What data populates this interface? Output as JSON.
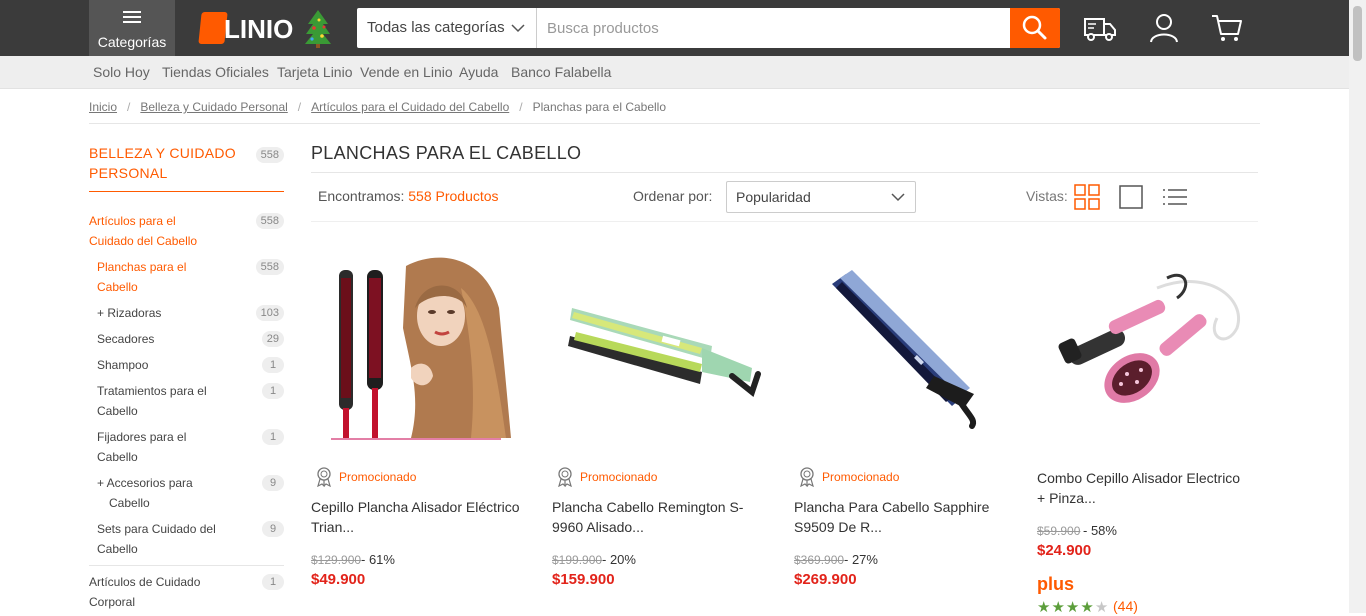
{
  "header": {
    "categories_label": "Categorías",
    "logo_text": "LINIO",
    "search": {
      "category_value": "Todas las categorías",
      "placeholder": "Busca productos"
    },
    "icons": [
      "shipping-truck-icon",
      "user-icon",
      "cart-icon"
    ]
  },
  "nav": {
    "links": [
      "Solo Hoy",
      "Tiendas Oficiales",
      "Tarjeta Linio",
      "Vende en Linio",
      "Ayuda",
      "Banco Falabella"
    ]
  },
  "breadcrumb": [
    "Inicio",
    "Belleza y Cuidado Personal",
    "Artículos para el Cuidado del Cabello",
    "Planchas para el Cabello"
  ],
  "sidebar": {
    "heading_line1": "BELLEZA Y CUIDADO",
    "heading_line2": "PERSONAL",
    "heading_count": "558",
    "items": [
      {
        "l1": "Artículos para el",
        "l2": "Cuidado del Cabello",
        "count": "558"
      },
      {
        "l1": "Planchas para el",
        "l2": "Cabello",
        "count": "558"
      },
      {
        "l1": "+ Rizadoras",
        "l2": "",
        "count": "103"
      },
      {
        "l1": "Secadores",
        "l2": "",
        "count": "29"
      },
      {
        "l1": "Shampoo",
        "l2": "",
        "count": "1"
      },
      {
        "l1": "Tratamientos para el",
        "l2": "Cabello",
        "count": "1"
      },
      {
        "l1": "Fijadores para el",
        "l2": "Cabello",
        "count": "1"
      },
      {
        "l1": "+ Accesorios para",
        "l2": "Cabello",
        "count": "9"
      },
      {
        "l1": "Sets para Cuidado del",
        "l2": "Cabello",
        "count": "9"
      },
      {
        "l1": "Artículos de Cuidado",
        "l2": "Corporal",
        "count": "1"
      }
    ]
  },
  "main": {
    "title": "PLANCHAS PARA EL CABELLO",
    "found_prefix": "Encontramos:",
    "found_count": "558 Productos",
    "sort_label": "Ordenar por:",
    "sort_value": "Popularidad",
    "views_label": "Vistas:"
  },
  "products": [
    {
      "promo": "Promocionado",
      "name1": "Cepillo Plancha Alisador Eléctrico",
      "name2": "Trian...",
      "old_price": "$129.900",
      "discount": "- 61%",
      "price": "$49.900"
    },
    {
      "promo": "Promocionado",
      "name1": "Plancha Cabello Remington S-",
      "name2": "9960 Alisado...",
      "old_price": "$199.900",
      "discount": "- 20%",
      "price": "$159.900"
    },
    {
      "promo": "Promocionado",
      "name1": "Plancha Para Cabello Sapphire",
      "name2": "S9509 De R...",
      "old_price": "$369.900",
      "discount": "- 27%",
      "price": "$269.900"
    },
    {
      "promo": "",
      "name1": "Combo Cepillo Alisador Electrico",
      "name2": "+ Pinza...",
      "old_price": "$59.900",
      "discount": "- 58%",
      "price": "$24.900",
      "plus": "plus",
      "rating": 4,
      "reviews": "(44)"
    }
  ],
  "colors": {
    "accent": "#ff5a00",
    "topbar": "#3b3b3b",
    "price": "#e2231a",
    "stars": "#5c9e3b"
  }
}
